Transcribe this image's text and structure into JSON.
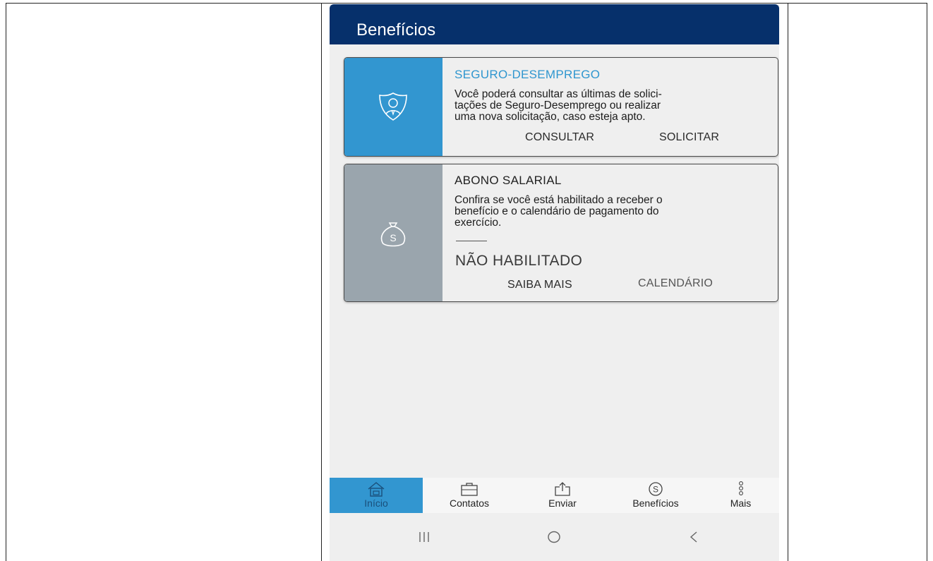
{
  "app": {
    "title": "Benefícios"
  },
  "cards": [
    {
      "title": "SEGURO-DESEMPREGO",
      "description": "Você poderá consultar as últimas  de solici-\ntações de Seguro-Desemprego ou realizar\numa nova solicitação, caso esteja apto.",
      "actions": [
        "CONSULTAR",
        "SOLICITAR"
      ],
      "icon": "shield-person-icon",
      "accent": "#3296d0"
    },
    {
      "title": "ABONO SALARIAL",
      "description": "Confira se você está habilitado  a receber o\nbenefício e o calendário de pagamento do\nexercício.",
      "status": "NÃO HABILITADO",
      "actions": [
        "SAIBA MAIS",
        "CALENDÁRIO"
      ],
      "icon": "money-bag-icon",
      "accent": "#9aa5ad"
    }
  ],
  "tabbar": {
    "items": [
      {
        "label": "Início",
        "icon": "home-icon",
        "active": true
      },
      {
        "label": "Contatos",
        "icon": "briefcase-icon",
        "active": false
      },
      {
        "label": "Enviar",
        "icon": "upload-icon",
        "active": false
      },
      {
        "label": "Benefícios",
        "icon": "dollar-circle-icon",
        "active": false
      },
      {
        "label": "Mais",
        "icon": "more-dots-icon",
        "active": false
      }
    ]
  },
  "system_nav": {
    "items": [
      "recent-apps-icon",
      "home-circle-icon",
      "back-icon"
    ]
  },
  "colors": {
    "header": "#06306b",
    "accent": "#3296d0",
    "disabled": "#9aa5ad"
  }
}
